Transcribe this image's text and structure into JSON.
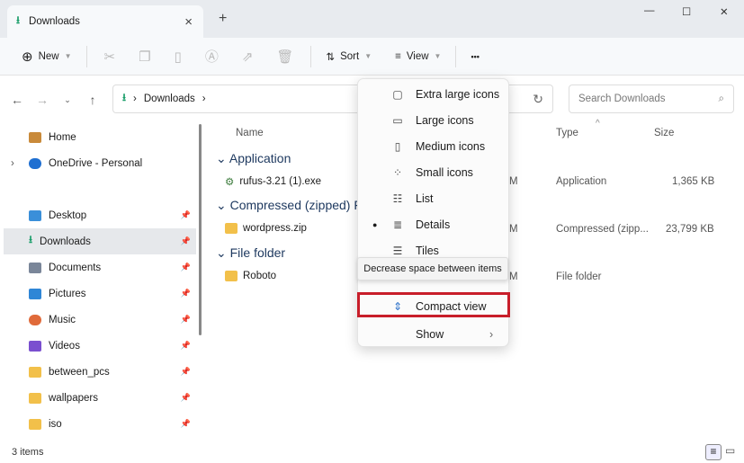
{
  "tab": {
    "title": "Downloads",
    "close": "×",
    "new_tab": "+"
  },
  "window": {
    "minimize": "—",
    "maximize": "☐",
    "close": "✕"
  },
  "toolbar": {
    "new": "New",
    "sort": "Sort",
    "view": "View",
    "more": "•••"
  },
  "address": {
    "crumb": "Downloads",
    "search_placeholder": "Search Downloads"
  },
  "sidebar": {
    "items": [
      {
        "label": "Home",
        "color": "#c98a3a"
      },
      {
        "label": "OneDrive - Personal",
        "color": "#1f6fd1"
      },
      {
        "label": "Desktop",
        "color": "#3a8fd9"
      },
      {
        "label": "Downloads",
        "color": "#1a9e6a"
      },
      {
        "label": "Documents",
        "color": "#7a8699"
      },
      {
        "label": "Pictures",
        "color": "#2f86d6"
      },
      {
        "label": "Music",
        "color": "#e06a3a"
      },
      {
        "label": "Videos",
        "color": "#7a4fcf"
      },
      {
        "label": "between_pcs",
        "color": "#f2c04a"
      },
      {
        "label": "wallpapers",
        "color": "#f2c04a"
      },
      {
        "label": "iso",
        "color": "#f2c04a"
      }
    ]
  },
  "columns": {
    "name": "Name",
    "type": "Type",
    "size": "Size"
  },
  "groups": [
    {
      "label": "Application",
      "file": "rufus-3.21 (1).exe",
      "date_tail": "M",
      "type": "Application",
      "size": "1,365 KB"
    },
    {
      "label": "Compressed (zipped) Fo",
      "file": "wordpress.zip",
      "date_tail": "M",
      "type": "Compressed (zipp...",
      "size": "23,799 KB"
    },
    {
      "label": "File folder",
      "file": "Roboto",
      "date_tail": "M",
      "type": "File folder",
      "size": ""
    }
  ],
  "menu": {
    "items": [
      "Extra large icons",
      "Large icons",
      "Medium icons",
      "Small icons",
      "List",
      "Details",
      "Tiles"
    ],
    "compact": "Compact view",
    "show": "Show",
    "tooltip": "Decrease space between items"
  },
  "status": {
    "count": "3 items"
  }
}
